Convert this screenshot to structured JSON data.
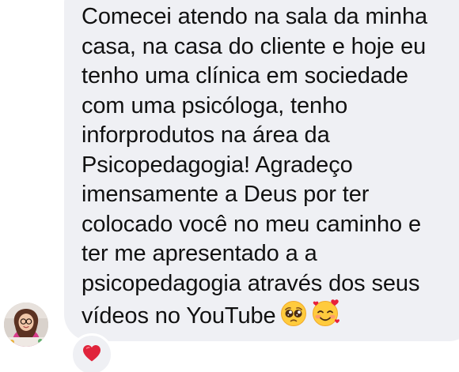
{
  "message": {
    "lines": [
      "Comecei atendo na sala da minha",
      "casa, na casa do cliente e hoje eu",
      "tenho uma clínica em sociedade",
      "com uma psicóloga, tenho",
      "inforprodutos na área da",
      "Psicopedagogia! Agradeço",
      "imensamente a Deus por ter",
      "colocado você no meu caminho e",
      "ter me apresentado a a",
      "psicopedagogia através dos seus",
      "vídeos no YouTube"
    ],
    "emojis": [
      "pleading-face-emoji",
      "smiling-face-with-hearts-emoji"
    ]
  },
  "reaction": {
    "icon": "red-heart-icon",
    "color": "#e0243b"
  },
  "colors": {
    "bubble": "#eff0f4",
    "text": "#111111",
    "background": "#ffffff"
  }
}
